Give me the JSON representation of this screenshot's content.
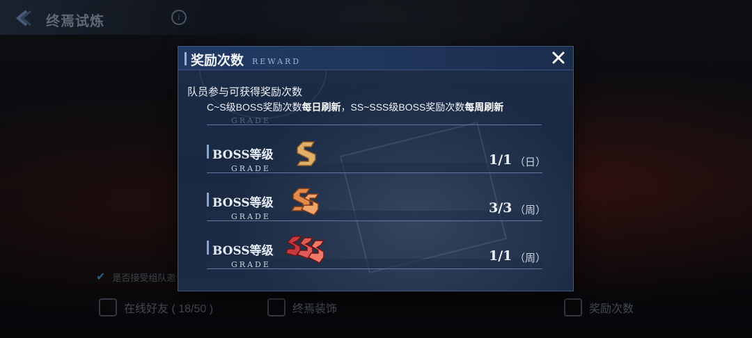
{
  "topbar": {
    "title": "终焉试炼"
  },
  "background": {
    "checkbox_label": "是否接受组队邀请",
    "bottom_items": [
      {
        "label": "在线好友 ( 18/50 )",
        "icon": "friends-icon"
      },
      {
        "label": "终焉装饰",
        "icon": "decoration-icon"
      },
      {
        "label": "奖励次数",
        "icon": "reward-count-icon"
      }
    ]
  },
  "modal": {
    "title": "奖励次数",
    "subtitle": "REWARD",
    "description": "队员参与可获得奖励次数",
    "note": {
      "part1": "C~S级BOSS奖励次数",
      "bold1": "每日刷新",
      "part2": "，SS~SSS级BOSS奖励次数",
      "bold2": "每周刷新"
    },
    "ghost_grade": "GRADE",
    "rows": [
      {
        "label": "BOSS等级",
        "grade": "GRADE",
        "rank": "S",
        "count": "1/1",
        "period": "（日）",
        "color": "#e0b06a"
      },
      {
        "label": "BOSS等级",
        "grade": "GRADE",
        "rank": "SS",
        "count": "3/3",
        "period": "（周）",
        "color": "#e08a4e"
      },
      {
        "label": "BOSS等级",
        "grade": "GRADE",
        "rank": "SSS",
        "count": "1/1",
        "period": "（周）",
        "color": "#d9474a"
      }
    ]
  },
  "colors": {
    "accent": "#7fa6de",
    "panel": "#1c2c47",
    "header": "#223a63"
  }
}
